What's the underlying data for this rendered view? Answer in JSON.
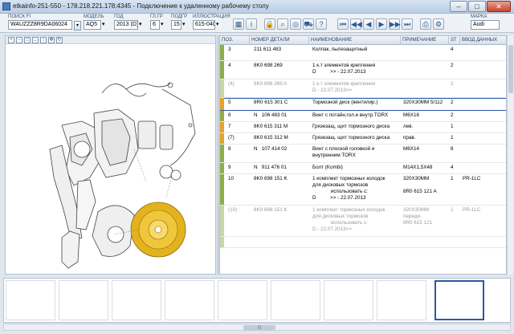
{
  "window": {
    "title": "etkainfo-251-550 - 178.218.221.178:4345 - Подключение к удаленному рабочему столу",
    "min": "–",
    "max": "□",
    "close": "✕"
  },
  "toolbar": {
    "search": {
      "label": "ПОИСК FI",
      "value": "WAUZZZ8R9DA06024"
    },
    "model": {
      "label": "МОДЕЛЬ",
      "value": "AQ5"
    },
    "year": {
      "label": "ГОД",
      "value": "2013 (D)"
    },
    "mgroup": {
      "label": "ГЛ.ГР",
      "value": "6"
    },
    "subgroup": {
      "label": "ПОДГР",
      "value": "15"
    },
    "illustration": {
      "label": "ИЛЛЮСТРАЦИЯ",
      "value": "615-040"
    },
    "brand": {
      "label": "МАРКА",
      "value": "Audi"
    }
  },
  "table": {
    "headers": [
      "ПОЗ.",
      "НОМЕР ДЕТАЛИ",
      "НАИМЕНОВАНИЕ",
      "ПРИМЕЧАНИЕ",
      "ST",
      "ВВОД ДАННЫХ"
    ],
    "rows": [
      {
        "pos": "3",
        "part": "211 611 483",
        "name": "Колпак, пылезащитный",
        "note": "",
        "st": "4",
        "data": "",
        "mark": "#8fae4a",
        "style": "normal"
      },
      {
        "pos": "4",
        "part": "8K0 698 269",
        "name": "1 к.т элементов крепления\nD          >> - 22.07.2013",
        "note": "",
        "st": "2",
        "data": "",
        "mark": "#8fae4a",
        "style": "normal"
      },
      {
        "pos": "(4)",
        "part": "8K0 698 269 A",
        "name": "1 к.т элементов крепления\nD - 22.07.2013>>",
        "note": "",
        "st": "2",
        "data": "",
        "mark": "#c8d6a8",
        "style": "gray"
      },
      {
        "pos": "5",
        "part": "8R0 615 301 C",
        "name": "Тормозной диск (вентилир.)",
        "note": "320X30MM 5/112",
        "st": "2",
        "data": "",
        "mark": "#e6a22a",
        "style": "sel"
      },
      {
        "pos": "6",
        "part": "N   106 483 01",
        "name": "Винт с потайн.гол.и внутр.TORX",
        "note": "M6X16",
        "st": "2",
        "data": "",
        "mark": "#8fae4a",
        "style": "normal"
      },
      {
        "pos": "7",
        "part": "8K0 615 311 M",
        "name": "Грязезащ. щит тормозного диска",
        "note": "лев.",
        "st": "1",
        "data": "",
        "mark": "#e6a22a",
        "style": "normal"
      },
      {
        "pos": "(7)",
        "part": "8K0 615 312 M",
        "name": "Грязезащ. щит тормозного диска",
        "note": "прав.",
        "st": "1",
        "data": "",
        "mark": "#e6a22a",
        "style": "normal"
      },
      {
        "pos": "8",
        "part": "N   107 414 02",
        "name": "Винт с плоской головкой и\nвнутренним TORX",
        "note": "M6X14",
        "st": "8",
        "data": "",
        "mark": "#8fae4a",
        "style": "normal"
      },
      {
        "pos": "9",
        "part": "N   911 476 01",
        "name": "Болт (Kombi)",
        "note": "M14X1,5X48",
        "st": "4",
        "data": "",
        "mark": "#8fae4a",
        "style": "normal"
      },
      {
        "pos": "10",
        "part": "8K0 698 151 K",
        "name": "1 комплект тормозных колодок\nдля дисковых тормозов\n             использовать с:\nD          >> - 22.07.2013",
        "note": "320X30MM\n\n8R0 615 121 A",
        "st": "1",
        "data": "PR-1LC",
        "mark": "#8fae4a",
        "style": "normal"
      },
      {
        "pos": "(10)",
        "part": "8K0 698 151 K",
        "name": "1 комплект тормозных колодок\nдля дисковых тормозов\n             использовать с:\nD - 22.07.2013>>",
        "note": "320X30MM\nпереди.\n8R0 615 121",
        "st": "1",
        "data": "PR-1LC",
        "mark": "#c8d6a8",
        "style": "gray"
      },
      {
        "pos": "",
        "part": "",
        "name": "",
        "note": "",
        "st": "",
        "data": "",
        "mark": "#c8d6a8",
        "style": "gray"
      }
    ]
  },
  "hscroll": {
    "grip": "|||"
  },
  "icons": {
    "lock": "lock-icon",
    "search": "search-icon"
  },
  "accent": "#2a58a8"
}
